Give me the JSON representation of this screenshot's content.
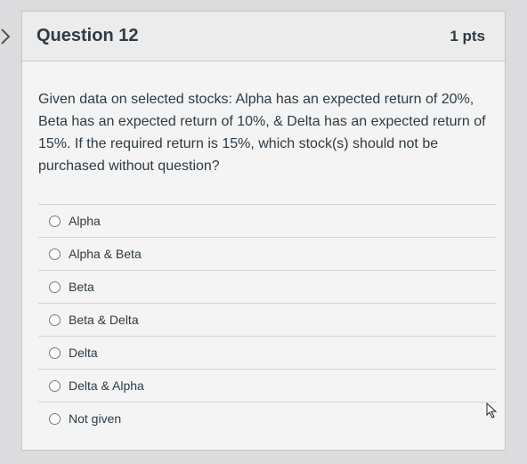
{
  "question": {
    "title": "Question 12",
    "points": "1 pts",
    "text": "Given data on selected stocks: Alpha has an expected return of 20%, Beta has an expected return of 10%, & Delta has an expected return of 15%. If the required return is 15%, which stock(s) should not be purchased without question?"
  },
  "answers": [
    {
      "label": "Alpha"
    },
    {
      "label": "Alpha & Beta"
    },
    {
      "label": "Beta"
    },
    {
      "label": "Beta & Delta"
    },
    {
      "label": "Delta"
    },
    {
      "label": "Delta & Alpha"
    },
    {
      "label": "Not given"
    }
  ],
  "icons": {
    "nav": "chevron-right-icon",
    "cursor": "mouse-pointer-icon",
    "radio": "radio-unselected-icon"
  },
  "colors": {
    "text": "#2d3b45",
    "header_bg": "#ececec",
    "card_bg": "#f4f4f4",
    "border": "#c6c6c6"
  }
}
